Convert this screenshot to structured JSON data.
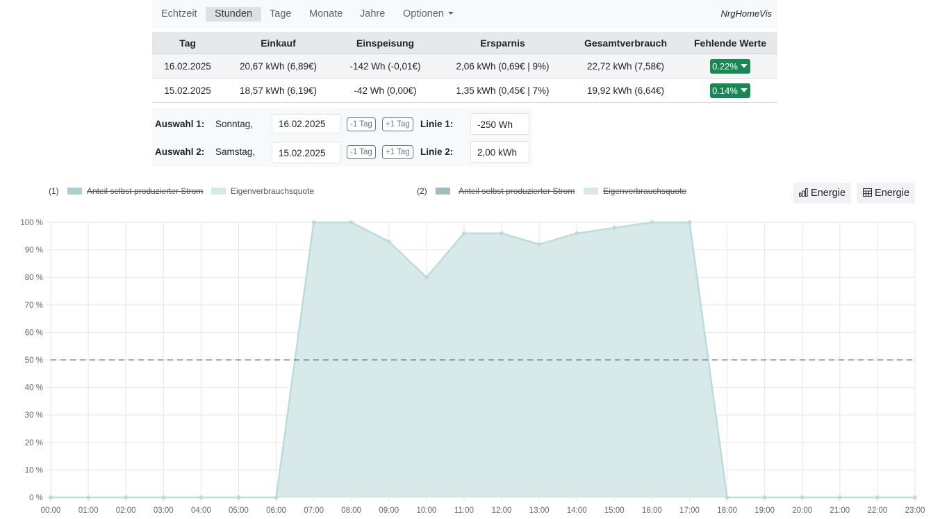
{
  "nav": {
    "items": [
      "Echtzeit",
      "Stunden",
      "Tage",
      "Monate",
      "Jahre",
      "Optionen"
    ],
    "active": "Stunden",
    "brand": "NrgHomeVis"
  },
  "summary": {
    "headers": [
      "Tag",
      "Einkauf",
      "Einspeisung",
      "Ersparnis",
      "Gesamtverbrauch",
      "Fehlende Werte"
    ],
    "rows": [
      [
        "16.02.2025",
        "20,67 kWh (6,89€)",
        "-142 Wh (-0,01€)",
        "2,06 kWh (0,69€ | 9%)",
        "22,72 kWh (7,58€)",
        "0.22%"
      ],
      [
        "15.02.2025",
        "18,57 kWh (6,19€)",
        "-42 Wh (0,00€)",
        "1,35 kWh (0,45€ | 7%)",
        "19,92 kWh (6,64€)",
        "0.14%"
      ]
    ]
  },
  "selection": {
    "row1": {
      "label": "Auswahl 1:",
      "weekday": "Sonntag,",
      "date": "16.02.2025",
      "minus": "-1 Tag",
      "plus": "+1 Tag",
      "line_label": "Linie 1:",
      "line_value": "-250 Wh"
    },
    "row2": {
      "label": "Auswahl 2:",
      "weekday": "Samstag,",
      "date": "15.02.2025",
      "minus": "-1 Tag",
      "plus": "+1 Tag",
      "line_label": "Linie 2:",
      "line_value": "2,00 kWh"
    }
  },
  "legend": {
    "group1": {
      "prefix": "(1)",
      "items": [
        "Anteil selbst produzierter Strom",
        "Eigenverbrauchsquote"
      ]
    },
    "group2": {
      "prefix": "(2)",
      "items": [
        "Anteil selbst produzierter Strom",
        "Eigenverbrauchsquote"
      ]
    }
  },
  "buttons": {
    "chart_view": "Energie",
    "table_view": "Energie"
  },
  "colors": {
    "series_fill": "#d5e8e7",
    "series_line": "#bcdcdb",
    "legend_swatch_dark": "#a9cfcf",
    "legend_swatch_light": "#d4e9e8",
    "legend2_swatch_dark": "#9ebdbc",
    "badge_green": "#198754"
  },
  "chart_data": {
    "type": "area",
    "x": [
      "00:00",
      "01:00",
      "02:00",
      "03:00",
      "04:00",
      "05:00",
      "06:00",
      "07:00",
      "08:00",
      "09:00",
      "10:00",
      "11:00",
      "12:00",
      "13:00",
      "14:00",
      "15:00",
      "16:00",
      "17:00",
      "18:00",
      "19:00",
      "20:00",
      "21:00",
      "22:00",
      "23:00"
    ],
    "series": [
      {
        "name": "Eigenverbrauchsquote",
        "values": [
          0,
          0,
          0,
          0,
          0,
          0,
          0,
          100,
          100,
          93,
          80,
          96,
          96,
          92,
          96,
          98,
          100,
          100,
          0,
          0,
          0,
          0,
          0,
          0
        ]
      }
    ],
    "y_ticks": [
      "0 %",
      "10 %",
      "20 %",
      "30 %",
      "40 %",
      "50 %",
      "60 %",
      "70 %",
      "80 %",
      "90 %",
      "100 %"
    ],
    "ylim": [
      0,
      100
    ],
    "reference_line": 50,
    "grid": true
  }
}
